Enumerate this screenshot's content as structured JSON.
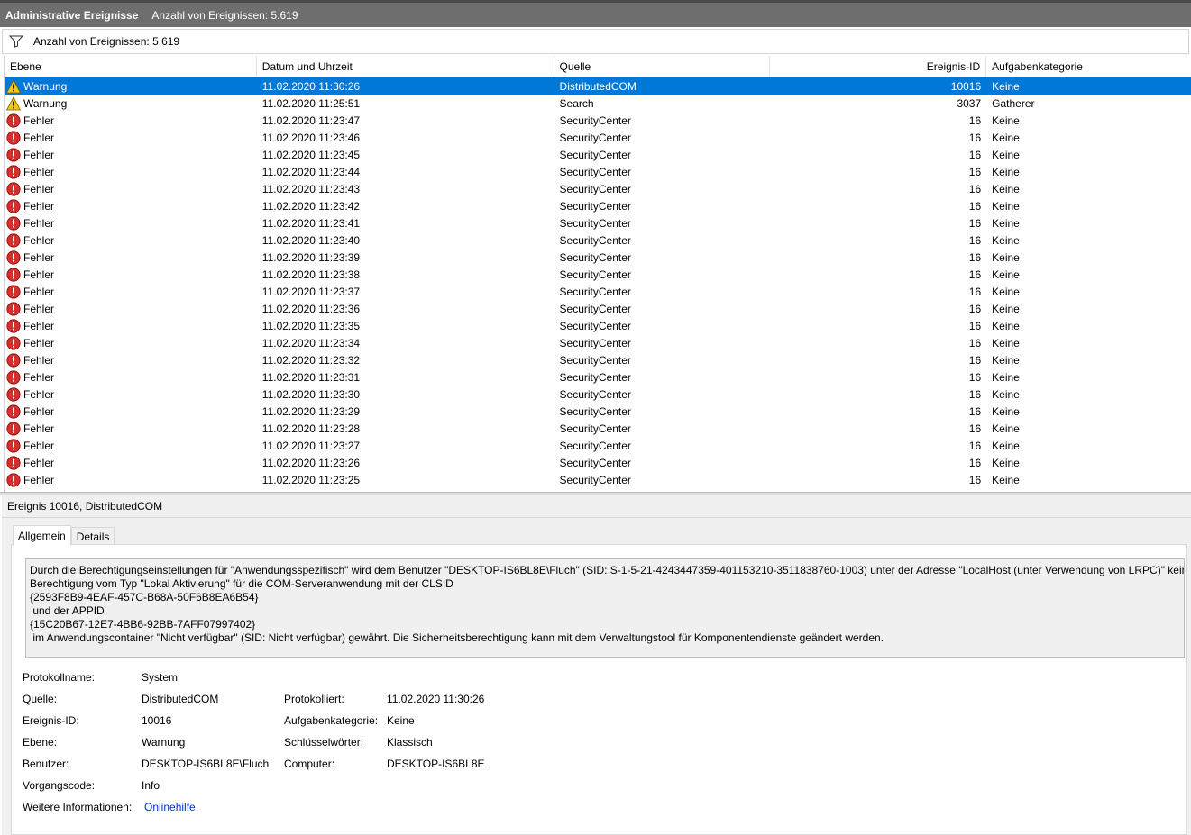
{
  "titlebar": {
    "title": "Administrative Ereignisse",
    "subtitle": "Anzahl von Ereignissen: 5.619"
  },
  "filterbar": {
    "text": "Anzahl von Ereignissen: 5.619",
    "icon": "filter-icon"
  },
  "columns": {
    "level": "Ebene",
    "datetime": "Datum und Uhrzeit",
    "source": "Quelle",
    "eventid": "Ereignis-ID",
    "category": "Aufgabenkategorie"
  },
  "events": [
    {
      "level": "Warnung",
      "type": "warning",
      "datetime": "11.02.2020 11:30:26",
      "source": "DistributedCOM",
      "eventid": "10016",
      "category": "Keine"
    },
    {
      "level": "Warnung",
      "type": "warning",
      "datetime": "11.02.2020 11:25:51",
      "source": "Search",
      "eventid": "3037",
      "category": "Gatherer"
    },
    {
      "level": "Fehler",
      "type": "error",
      "datetime": "11.02.2020 11:23:47",
      "source": "SecurityCenter",
      "eventid": "16",
      "category": "Keine"
    },
    {
      "level": "Fehler",
      "type": "error",
      "datetime": "11.02.2020 11:23:46",
      "source": "SecurityCenter",
      "eventid": "16",
      "category": "Keine"
    },
    {
      "level": "Fehler",
      "type": "error",
      "datetime": "11.02.2020 11:23:45",
      "source": "SecurityCenter",
      "eventid": "16",
      "category": "Keine"
    },
    {
      "level": "Fehler",
      "type": "error",
      "datetime": "11.02.2020 11:23:44",
      "source": "SecurityCenter",
      "eventid": "16",
      "category": "Keine"
    },
    {
      "level": "Fehler",
      "type": "error",
      "datetime": "11.02.2020 11:23:43",
      "source": "SecurityCenter",
      "eventid": "16",
      "category": "Keine"
    },
    {
      "level": "Fehler",
      "type": "error",
      "datetime": "11.02.2020 11:23:42",
      "source": "SecurityCenter",
      "eventid": "16",
      "category": "Keine"
    },
    {
      "level": "Fehler",
      "type": "error",
      "datetime": "11.02.2020 11:23:41",
      "source": "SecurityCenter",
      "eventid": "16",
      "category": "Keine"
    },
    {
      "level": "Fehler",
      "type": "error",
      "datetime": "11.02.2020 11:23:40",
      "source": "SecurityCenter",
      "eventid": "16",
      "category": "Keine"
    },
    {
      "level": "Fehler",
      "type": "error",
      "datetime": "11.02.2020 11:23:39",
      "source": "SecurityCenter",
      "eventid": "16",
      "category": "Keine"
    },
    {
      "level": "Fehler",
      "type": "error",
      "datetime": "11.02.2020 11:23:38",
      "source": "SecurityCenter",
      "eventid": "16",
      "category": "Keine"
    },
    {
      "level": "Fehler",
      "type": "error",
      "datetime": "11.02.2020 11:23:37",
      "source": "SecurityCenter",
      "eventid": "16",
      "category": "Keine"
    },
    {
      "level": "Fehler",
      "type": "error",
      "datetime": "11.02.2020 11:23:36",
      "source": "SecurityCenter",
      "eventid": "16",
      "category": "Keine"
    },
    {
      "level": "Fehler",
      "type": "error",
      "datetime": "11.02.2020 11:23:35",
      "source": "SecurityCenter",
      "eventid": "16",
      "category": "Keine"
    },
    {
      "level": "Fehler",
      "type": "error",
      "datetime": "11.02.2020 11:23:34",
      "source": "SecurityCenter",
      "eventid": "16",
      "category": "Keine"
    },
    {
      "level": "Fehler",
      "type": "error",
      "datetime": "11.02.2020 11:23:32",
      "source": "SecurityCenter",
      "eventid": "16",
      "category": "Keine"
    },
    {
      "level": "Fehler",
      "type": "error",
      "datetime": "11.02.2020 11:23:31",
      "source": "SecurityCenter",
      "eventid": "16",
      "category": "Keine"
    },
    {
      "level": "Fehler",
      "type": "error",
      "datetime": "11.02.2020 11:23:30",
      "source": "SecurityCenter",
      "eventid": "16",
      "category": "Keine"
    },
    {
      "level": "Fehler",
      "type": "error",
      "datetime": "11.02.2020 11:23:29",
      "source": "SecurityCenter",
      "eventid": "16",
      "category": "Keine"
    },
    {
      "level": "Fehler",
      "type": "error",
      "datetime": "11.02.2020 11:23:28",
      "source": "SecurityCenter",
      "eventid": "16",
      "category": "Keine"
    },
    {
      "level": "Fehler",
      "type": "error",
      "datetime": "11.02.2020 11:23:27",
      "source": "SecurityCenter",
      "eventid": "16",
      "category": "Keine"
    },
    {
      "level": "Fehler",
      "type": "error",
      "datetime": "11.02.2020 11:23:26",
      "source": "SecurityCenter",
      "eventid": "16",
      "category": "Keine"
    },
    {
      "level": "Fehler",
      "type": "error",
      "datetime": "11.02.2020 11:23:25",
      "source": "SecurityCenter",
      "eventid": "16",
      "category": "Keine"
    }
  ],
  "detail": {
    "title": "Ereignis 10016, DistributedCOM",
    "tabs": [
      "Allgemein",
      "Details"
    ],
    "message": [
      "Durch die Berechtigungseinstellungen für \"Anwendungsspezifisch\" wird dem Benutzer \"DESKTOP-IS6BL8E\\Fluch\" (SID: S-1-5-21-4243447359-401153210-3511838760-1003) unter der Adresse \"LocalHost (unter Verwendung von LRPC)\" keine",
      "Berechtigung vom Typ \"Lokal Aktivierung\" für die COM-Serveranwendung mit der CLSID",
      "{2593F8B9-4EAF-457C-B68A-50F6B8EA6B54}",
      " und der APPID",
      "{15C20B67-12E7-4BB6-92BB-7AFF07997402}",
      " im Anwendungscontainer \"Nicht verfügbar\" (SID: Nicht verfügbar) gewährt. Die Sicherheitsberechtigung kann mit dem Verwaltungstool für Komponentendienste geändert werden."
    ],
    "props": {
      "protokollname_label": "Protokollname:",
      "protokollname": "System",
      "quelle_label": "Quelle:",
      "quelle": "DistributedCOM",
      "protokolliert_label": "Protokolliert:",
      "protokolliert": "11.02.2020 11:30:26",
      "ereignisid_label": "Ereignis-ID:",
      "ereignisid": "10016",
      "aufgabe_label": "Aufgabenkategorie:",
      "aufgabe": "Keine",
      "ebene_label": "Ebene:",
      "ebene": "Warnung",
      "schluessel_label": "Schlüsselwörter:",
      "schluessel": "Klassisch",
      "benutzer_label": "Benutzer:",
      "benutzer": "DESKTOP-IS6BL8E\\Fluch",
      "computer_label": "Computer:",
      "computer": "DESKTOP-IS6BL8E",
      "vorgang_label": "Vorgangscode:",
      "vorgang": "Info",
      "weitere_label": "Weitere Informationen:",
      "weitere_link": "Onlinehilfe"
    }
  },
  "colors": {
    "selection": "#0078d7",
    "error": "#d32f2f",
    "warning": "#f5c518",
    "link": "#0033cc"
  }
}
